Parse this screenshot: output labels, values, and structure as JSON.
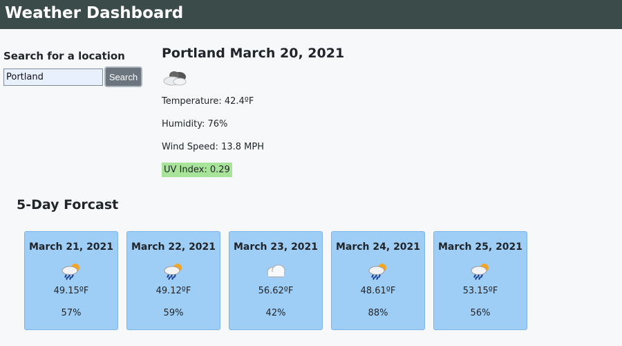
{
  "header": {
    "title": "Weather Dashboard"
  },
  "search": {
    "label": "Search for a location",
    "value": "Portland",
    "button": "Search"
  },
  "current": {
    "heading": "Portland March 20, 2021",
    "icon": "cloudy-icon",
    "temperature": "Temperature: 42.4ºF",
    "humidity": "Humidity: 76%",
    "wind": "Wind Speed: 13.8 MPH",
    "uv": "UV Index: 0.29",
    "uv_color": "#a8e39a"
  },
  "forecast": {
    "title": "5-Day Forcast",
    "days": [
      {
        "date": "March 21, 2021",
        "icon": "rain-sun-icon",
        "temp": "49.15ºF",
        "humidity": "57%"
      },
      {
        "date": "March 22, 2021",
        "icon": "rain-sun-icon",
        "temp": "49.12ºF",
        "humidity": "59%"
      },
      {
        "date": "March 23, 2021",
        "icon": "cloud-icon",
        "temp": "56.62ºF",
        "humidity": "42%"
      },
      {
        "date": "March 24, 2021",
        "icon": "rain-sun-icon",
        "temp": "48.61ºF",
        "humidity": "88%"
      },
      {
        "date": "March 25, 2021",
        "icon": "rain-sun-icon",
        "temp": "53.15ºF",
        "humidity": "56%"
      }
    ]
  },
  "colors": {
    "header": "#3a4b4a",
    "card": "#9ecdf5",
    "button": "#6c757d"
  }
}
